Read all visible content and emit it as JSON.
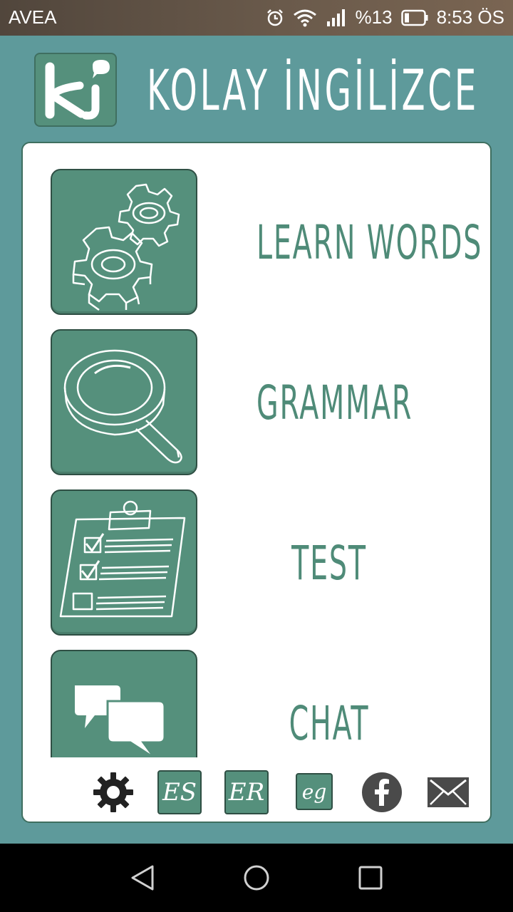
{
  "status_bar": {
    "carrier": "AVEA",
    "battery": "%13",
    "time": "8:53 ÖS",
    "icons": [
      "alarm-icon",
      "wifi-icon",
      "signal-icon",
      "battery-icon"
    ]
  },
  "header": {
    "logo_text": "ki",
    "title": "KOLAY İNGİLİZCE"
  },
  "menu": {
    "items": [
      {
        "label": "LEARN WORDS",
        "icon": "gears-icon"
      },
      {
        "label": "GRAMMAR",
        "icon": "magnifier-icon"
      },
      {
        "label": "TEST",
        "icon": "clipboard-icon"
      },
      {
        "label": "CHAT",
        "icon": "chat-bubbles-icon"
      }
    ]
  },
  "toolbar": {
    "items": [
      {
        "name": "settings",
        "icon": "gear-icon"
      },
      {
        "name": "es",
        "label": "ES"
      },
      {
        "name": "er",
        "label": "ER"
      },
      {
        "name": "eg",
        "label": "eg"
      },
      {
        "name": "facebook",
        "icon": "facebook-icon"
      },
      {
        "name": "mail",
        "icon": "mail-icon"
      }
    ]
  },
  "colors": {
    "background": "#5e9a9b",
    "accent": "#55907c",
    "label_text": "#4f8b78",
    "card": "#ffffff"
  },
  "nav_bar": {
    "icons": [
      "back-icon",
      "home-icon",
      "recents-icon"
    ]
  }
}
